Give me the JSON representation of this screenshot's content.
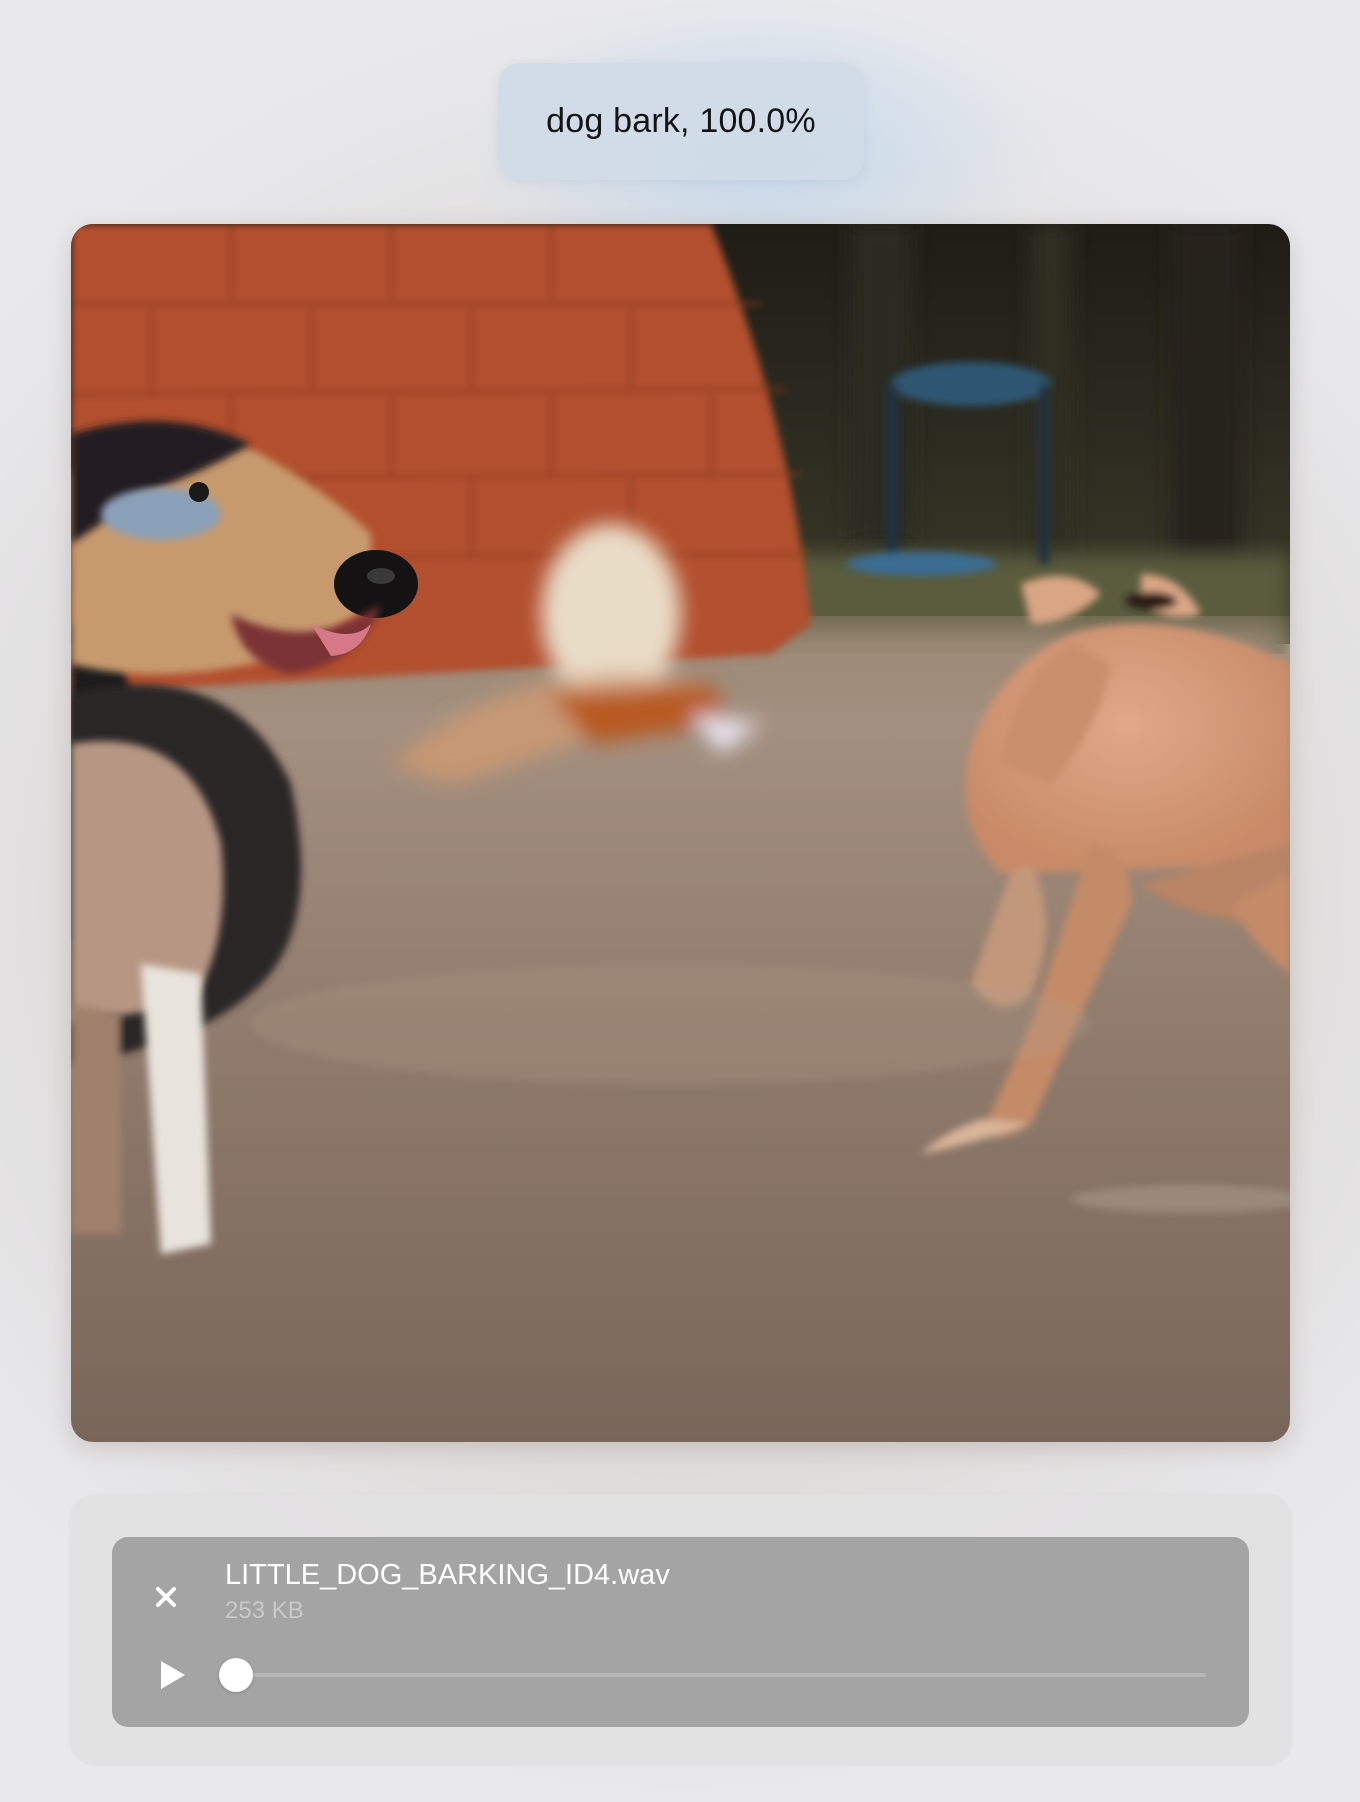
{
  "classification": {
    "label": "dog bark, 100.0%"
  },
  "media": {
    "icon": "photo-image"
  },
  "audio_player": {
    "file_name": "LITTLE_DOG_BARKING_ID4.wav",
    "file_size": "253 KB",
    "progress": 0.0,
    "close_icon": "close-icon",
    "play_icon": "play-icon"
  }
}
